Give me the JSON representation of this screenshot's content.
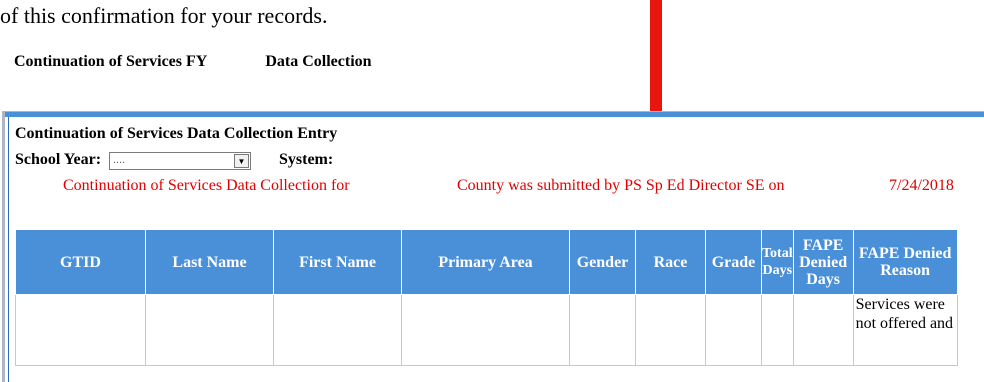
{
  "document": {
    "intro_text": "of this confirmation for your records."
  },
  "page": {
    "title_prefix": "Continuation of Services FY",
    "title_suffix": "Data Collection"
  },
  "form": {
    "title": "Continuation of Services Data Collection Entry",
    "school_year_label": "School Year:",
    "school_year_value": "....",
    "system_label": "System:",
    "confirmation_part1": "Continuation of Services Data Collection for",
    "confirmation_part2": "County was submitted by PS Sp Ed Director SE on",
    "confirmation_date": "7/24/2018"
  },
  "table": {
    "headers": [
      "GTID",
      "Last Name",
      "First Name",
      "Primary Area",
      "Gender",
      "Race",
      "Grade",
      "Total Days",
      "FAPE Denied Days",
      "FAPE Denied Reason"
    ],
    "rows": [
      [
        "",
        "",
        "",
        "",
        "",
        "",
        "",
        "",
        "",
        "Services were not offered and"
      ]
    ]
  },
  "colors": {
    "accent": "#4a90d9",
    "alert_red": "#e00000",
    "arrow_red": "#e8160c"
  }
}
